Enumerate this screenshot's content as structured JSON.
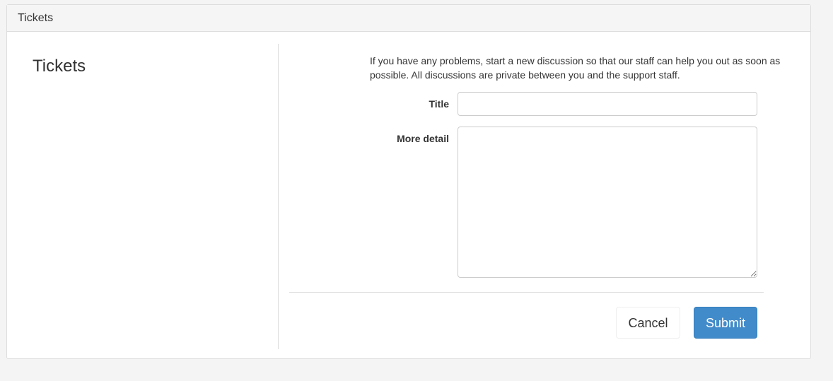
{
  "panel": {
    "heading": "Tickets"
  },
  "sidebar": {
    "title": "Tickets"
  },
  "main": {
    "intro": "If you have any problems, start a new discussion so that our staff can help you out as soon as possible. All discussions are private between you and the support staff.",
    "form": {
      "title_label": "Title",
      "title_value": "",
      "detail_label": "More detail",
      "detail_value": ""
    },
    "actions": {
      "cancel_label": "Cancel",
      "submit_label": "Submit"
    }
  },
  "colors": {
    "page_background": "#f4f4f4",
    "primary": "#428bca",
    "border": "#dddddd"
  }
}
